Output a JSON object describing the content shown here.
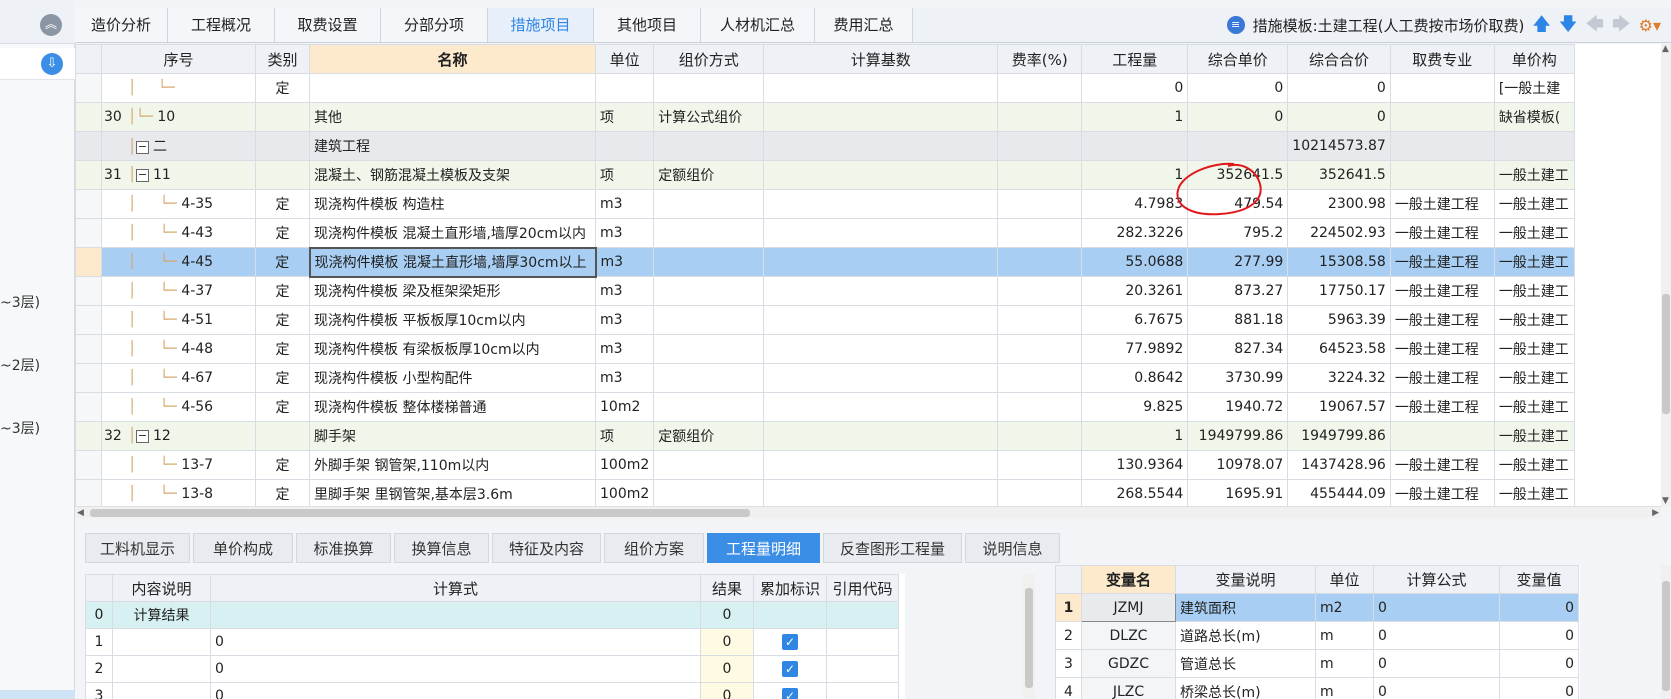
{
  "top_tabs": [
    "造价分析",
    "工程概况",
    "取费设置",
    "分部分项",
    "措施项目",
    "其他项目",
    "人材机汇总",
    "费用汇总"
  ],
  "template_label": "措施模板:土建工程(人工费按市场价取费)",
  "left_panel_items": [
    "~3层)",
    "~2层)",
    "~3层)"
  ],
  "main_headers": [
    "序号",
    "类别",
    "名称",
    "单位",
    "组价方式",
    "计算基数",
    "费率(%)",
    "工程量",
    "综合单价",
    "综合合价",
    "取费专业",
    "单价构"
  ],
  "main_rows": [
    {
      "no": "",
      "code": "",
      "type": "定",
      "name": "",
      "unit": "",
      "method": "",
      "base": "",
      "rate": "",
      "qty": "0",
      "price": "0",
      "total": "0",
      "spec": "",
      "extra": "[一般土建",
      "style": ""
    },
    {
      "no": "30",
      "code": "10",
      "type": "",
      "name": "其他",
      "unit": "项",
      "method": "计算公式组价",
      "base": "",
      "rate": "",
      "qty": "1",
      "price": "0",
      "total": "0",
      "spec": "",
      "extra": "缺省模板(",
      "style": "green"
    },
    {
      "no": "",
      "code": "二",
      "type": "",
      "name": "建筑工程",
      "unit": "",
      "method": "",
      "base": "",
      "rate": "",
      "qty": "",
      "price": "",
      "total": "10214573.87",
      "spec": "",
      "extra": "",
      "style": "grey"
    },
    {
      "no": "31",
      "code": "11",
      "type": "",
      "name": "混凝土、钢筋混凝土模板及支架",
      "unit": "项",
      "method": "定额组价",
      "base": "",
      "rate": "",
      "qty": "1",
      "price": "352641.5",
      "total": "352641.5",
      "spec": "",
      "extra": "一般土建工",
      "style": "green"
    },
    {
      "no": "",
      "code": "4-35",
      "type": "定",
      "name": "现浇构件模板 构造柱",
      "unit": "m3",
      "method": "",
      "base": "",
      "rate": "",
      "qty": "4.7983",
      "price": "479.54",
      "total": "2300.98",
      "spec": "一般土建工程",
      "extra": "一般土建工",
      "style": ""
    },
    {
      "no": "",
      "code": "4-43",
      "type": "定",
      "name": "现浇构件模板 混凝土直形墙,墙厚20cm以内",
      "unit": "m3",
      "method": "",
      "base": "",
      "rate": "",
      "qty": "282.3226",
      "price": "795.2",
      "total": "224502.93",
      "spec": "一般土建工程",
      "extra": "一般土建工",
      "style": ""
    },
    {
      "no": "",
      "code": "4-45",
      "type": "定",
      "name": "现浇构件模板 混凝土直形墙,墙厚30cm以上",
      "unit": "m3",
      "method": "",
      "base": "",
      "rate": "",
      "qty": "55.0688",
      "price": "277.99",
      "total": "15308.58",
      "spec": "一般土建工程",
      "extra": "一般土建工",
      "style": "sel"
    },
    {
      "no": "",
      "code": "4-37",
      "type": "定",
      "name": "现浇构件模板 梁及框架梁矩形",
      "unit": "m3",
      "method": "",
      "base": "",
      "rate": "",
      "qty": "20.3261",
      "price": "873.27",
      "total": "17750.17",
      "spec": "一般土建工程",
      "extra": "一般土建工",
      "style": ""
    },
    {
      "no": "",
      "code": "4-51",
      "type": "定",
      "name": "现浇构件模板 平板板厚10cm以内",
      "unit": "m3",
      "method": "",
      "base": "",
      "rate": "",
      "qty": "6.7675",
      "price": "881.18",
      "total": "5963.39",
      "spec": "一般土建工程",
      "extra": "一般土建工",
      "style": ""
    },
    {
      "no": "",
      "code": "4-48",
      "type": "定",
      "name": "现浇构件模板 有梁板板厚10cm以内",
      "unit": "m3",
      "method": "",
      "base": "",
      "rate": "",
      "qty": "77.9892",
      "price": "827.34",
      "total": "64523.58",
      "spec": "一般土建工程",
      "extra": "一般土建工",
      "style": ""
    },
    {
      "no": "",
      "code": "4-67",
      "type": "定",
      "name": "现浇构件模板 小型构配件",
      "unit": "m3",
      "method": "",
      "base": "",
      "rate": "",
      "qty": "0.8642",
      "price": "3730.99",
      "total": "3224.32",
      "spec": "一般土建工程",
      "extra": "一般土建工",
      "style": ""
    },
    {
      "no": "",
      "code": "4-56",
      "type": "定",
      "name": "现浇构件模板 整体楼梯普通",
      "unit": "10m2",
      "method": "",
      "base": "",
      "rate": "",
      "qty": "9.825",
      "price": "1940.72",
      "total": "19067.57",
      "spec": "一般土建工程",
      "extra": "一般土建工",
      "style": ""
    },
    {
      "no": "32",
      "code": "12",
      "type": "",
      "name": "脚手架",
      "unit": "项",
      "method": "定额组价",
      "base": "",
      "rate": "",
      "qty": "1",
      "price": "1949799.86",
      "total": "1949799.86",
      "spec": "",
      "extra": "一般土建工",
      "style": "green"
    },
    {
      "no": "",
      "code": "13-7",
      "type": "定",
      "name": "外脚手架 钢管架,110m以内",
      "unit": "100m2",
      "method": "",
      "base": "",
      "rate": "",
      "qty": "130.9364",
      "price": "10978.07",
      "total": "1437428.96",
      "spec": "一般土建工程",
      "extra": "一般土建工",
      "style": ""
    },
    {
      "no": "",
      "code": "13-8",
      "type": "定",
      "name": "里脚手架 里钢管架,基本层3.6m",
      "unit": "100m2",
      "method": "",
      "base": "",
      "rate": "",
      "qty": "268.5544",
      "price": "1695.91",
      "total": "455444.09",
      "spec": "一般土建工程",
      "extra": "一般土建工",
      "style": ""
    }
  ],
  "bottom_tabs": [
    "工料机显示",
    "单价构成",
    "标准换算",
    "换算信息",
    "特征及内容",
    "组价方案",
    "工程量明细",
    "反查图形工程量",
    "说明信息"
  ],
  "bl_headers": [
    "内容说明",
    "计算式",
    "结果",
    "累加标识",
    "引用代码"
  ],
  "bl_rows": [
    {
      "idx": "0",
      "desc": "计算结果",
      "formula": "",
      "result": "0",
      "check": false
    },
    {
      "idx": "1",
      "desc": "",
      "formula": "0",
      "result": "0",
      "check": true
    },
    {
      "idx": "2",
      "desc": "",
      "formula": "0",
      "result": "0",
      "check": true
    },
    {
      "idx": "3",
      "desc": "",
      "formula": "0",
      "result": "0",
      "check": true
    }
  ],
  "br_headers": [
    "变量名",
    "变量说明",
    "单位",
    "计算公式",
    "变量值"
  ],
  "br_rows": [
    {
      "idx": "1",
      "code": "JZMJ",
      "desc": "建筑面积",
      "unit": "m2",
      "formula": "0",
      "value": "0"
    },
    {
      "idx": "2",
      "code": "DLZC",
      "desc": "道路总长(m)",
      "unit": "m",
      "formula": "0",
      "value": "0"
    },
    {
      "idx": "3",
      "code": "GDZC",
      "desc": "管道总长",
      "unit": "m",
      "formula": "0",
      "value": "0"
    },
    {
      "idx": "4",
      "code": "JLZC",
      "desc": "桥梁总长(m)",
      "unit": "m",
      "formula": "0",
      "value": "0"
    }
  ],
  "colors": {
    "accent": "#3a8ee6",
    "selected_row": "#a8cef3",
    "header_highlight": "#fde9cc",
    "annotation": "#e0181e"
  }
}
